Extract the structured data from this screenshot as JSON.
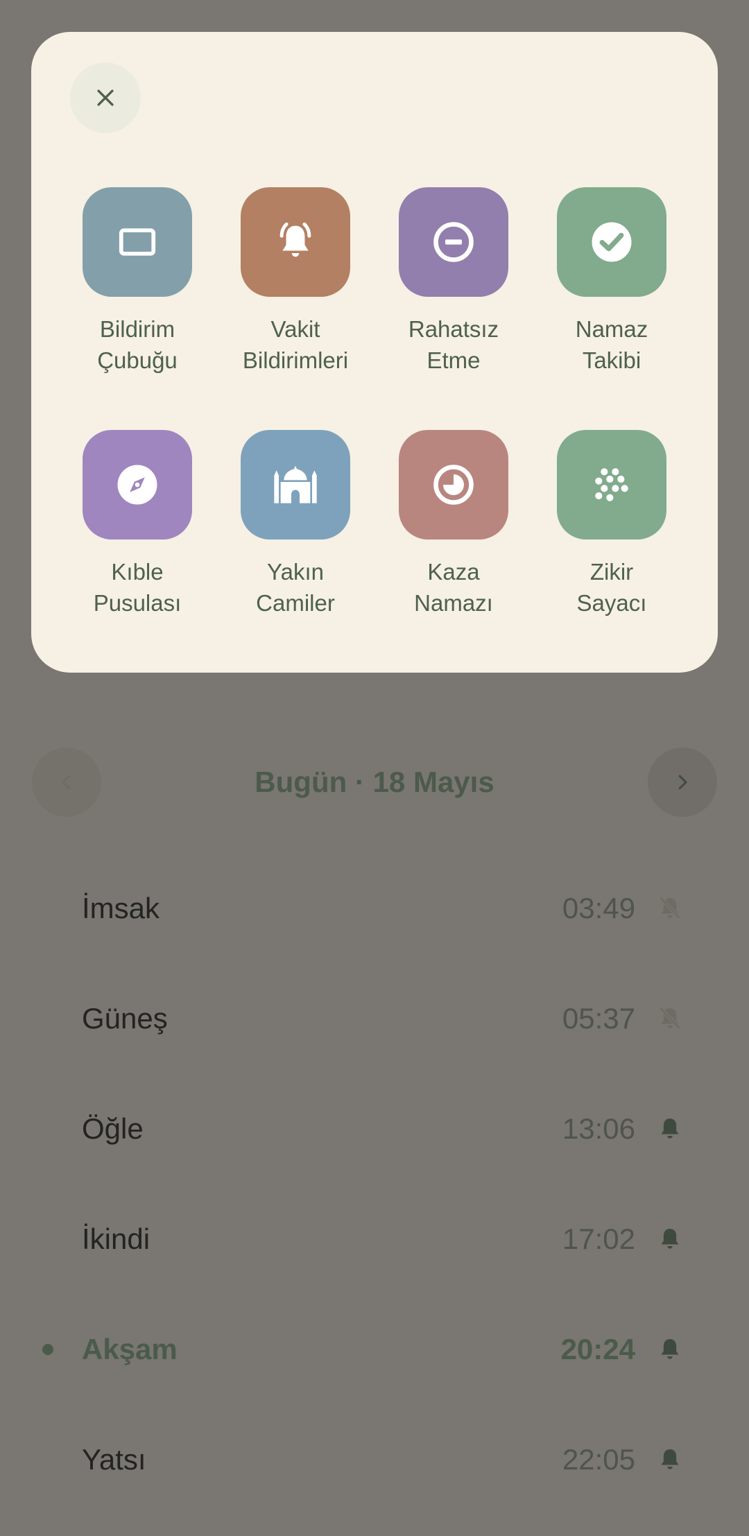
{
  "date_nav": {
    "title": "Bugün · 18 Mayıs",
    "prev_icon": "chevron-left-icon",
    "next_icon": "chevron-right-icon"
  },
  "prayers": [
    {
      "name": "İmsak",
      "time": "03:49",
      "notification": "off",
      "active": false
    },
    {
      "name": "Güneş",
      "time": "05:37",
      "notification": "off",
      "active": false
    },
    {
      "name": "Öğle",
      "time": "13:06",
      "notification": "on",
      "active": false
    },
    {
      "name": "İkindi",
      "time": "17:02",
      "notification": "on",
      "active": false
    },
    {
      "name": "Akşam",
      "time": "20:24",
      "notification": "on",
      "active": true
    },
    {
      "name": "Yatsı",
      "time": "22:05",
      "notification": "on",
      "active": false
    }
  ],
  "menu": {
    "close_icon": "close-icon",
    "items": [
      {
        "line1": "Bildirim",
        "line2": "Çubuğu",
        "icon": "notification-bar-icon",
        "color": "#83a0aa"
      },
      {
        "line1": "Vakit",
        "line2": "Bildirimleri",
        "icon": "bell-ringing-icon",
        "color": "#b38063"
      },
      {
        "line1": "Rahatsız",
        "line2": "Etme",
        "icon": "do-not-disturb-icon",
        "color": "#927fad"
      },
      {
        "line1": "Namaz",
        "line2": "Takibi",
        "icon": "check-circle-icon",
        "color": "#81ab8c"
      },
      {
        "line1": "Kıble",
        "line2": "Pusulası",
        "icon": "compass-icon",
        "color": "#a086bf"
      },
      {
        "line1": "Yakın",
        "line2": "Camiler",
        "icon": "mosque-icon",
        "color": "#7ea2bb"
      },
      {
        "line1": "Kaza",
        "line2": "Namazı",
        "icon": "history-clock-icon",
        "color": "#b8867f"
      },
      {
        "line1": "Zikir",
        "line2": "Sayacı",
        "icon": "prayer-beads-icon",
        "color": "#81ab8c"
      }
    ]
  },
  "colors": {
    "overlay": "#7a7671",
    "panel": "#f6f1e4",
    "accent_green": "#4a5b4a"
  }
}
